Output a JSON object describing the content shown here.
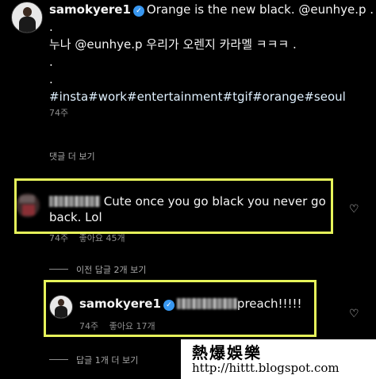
{
  "post": {
    "username": "samokyere1",
    "caption_line1": "Orange is the new black. @eunhye.p .",
    "caption_line2": ".",
    "caption_line3": "누나 @eunhye.p  우리가 오렌지 카라멜 ㅋㅋㅋ .",
    "caption_line4": ".",
    "caption_line5": ".",
    "hashtags": "#insta#work#entertainment#tgif#orange#seoul",
    "time": "74주"
  },
  "view_more_comments": "댓글 더 보기",
  "comment1": {
    "text": "Cute once you go black you never go",
    "text_line2": "back. Lol",
    "time": "74주",
    "likes": "좋아요 45개"
  },
  "view_previous_replies": "이전 답글 2개 보기",
  "reply": {
    "username": "samokyere1",
    "text": "preach!!!!!",
    "time": "74주",
    "likes": "좋아요 17개"
  },
  "view_more_replies": "답글 1개 더 보기",
  "icons": {
    "heart": "heart-icon",
    "verified": "verified-badge-icon"
  },
  "colors": {
    "background": "#000000",
    "highlight": "#e6f45a",
    "verified": "#3897f0"
  },
  "watermark": {
    "title": "熱爆娛樂",
    "url": "http://hittt.blogspot.com"
  }
}
